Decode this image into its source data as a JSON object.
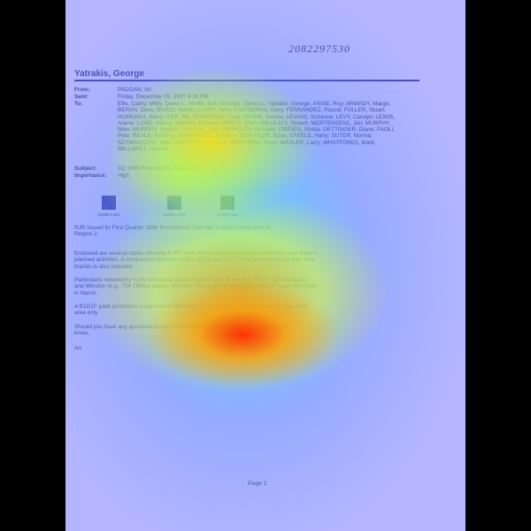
{
  "document": {
    "barcode": "2082297530",
    "sender_name": "Yatrakis, George",
    "headers": [
      {
        "label": "From:",
        "value": "PADOAN, Art"
      },
      {
        "label": "Sent:",
        "value": "Friday, December 05, 1997 4:36 PM"
      },
      {
        "label": "To:",
        "value": "Ellis, Cathy; Milby, David L.; Moffitt, Bob; Myracle, James L; Yatrakis, George; ANISE, Roy; ARWADY, Marge; BERAN, Dave; BUSS2, Martin; CLARY, John; EASTBURN1, Gary; FERNANDEZ, Pascal; FULLER, Stuart; HOPKINS1, Barry; ILER, Bill; JOHNSON3, Craig; KEANE, Denise; LEVAN1, Suzanne; LEVY, Carolyn; LEWIS, Arlene; LUND, Nancy; MAHAN, Michael; MERLO, Ellen; MIKULAY1, Robert; MORTENSEN1, Jim; MURPHY, Mike; MURPHY, Virginia; NELSON, Jack; NICHOLES, Nichelle; O'BRIEN, Sheila; OETTINGER, Diane; PAOLI, Pete; REALE, Anthony; SARMENTO1, Roberto; SCHUYLER, Brian; STEELE, Harry; SUTER, Norma; SZYMANCZYK, Mike; WALTERS1, Jerome; WEBSTER1, Ross; WEXLER, Larry; WHATFORD1, Mark; WILLARD1, Howard"
      },
      {
        "label": "Subject:",
        "value": "1Q 1998 Promotional Plan -RJR"
      },
      {
        "label": "Importance:",
        "value": "High"
      }
    ],
    "attachments": [
      {
        "filename": "1Q98Co.doc",
        "color": "#1c1c6e"
      },
      {
        "filename": "1Q98Co.doc",
        "color": "#1e5a6e"
      },
      {
        "filename": "1Q98Pr.doc",
        "color": "#4a6a1a"
      }
    ],
    "paragraphs": [
      "RJR issued its First Quarter 1998 Promotional Calendar to local wholesalers in Region 2.",
      "Enclosed are several tables showing RJR's core brand promotions versus Marlboro's and Basic's planned activities.  A comparison between RJR's 1Q'98 and 1Q'97 retail promotions for their core brands is also included.",
      "Particularly noteworthy is the increased support behind both Doral (e.g., $1.00 Off/two packs) and Winston (e.g., 70¢ Off/two packs).  Winston Ultra Lights Box will run a B2G1F pack promotion in March.",
      "A B1G1F pack promotion is planned in February for Salem Natural Slide Box in the New York area only.",
      "Should you have any questions or comments regarding this information, please let me know.",
      "Art"
    ],
    "page_label": "Page 1"
  }
}
